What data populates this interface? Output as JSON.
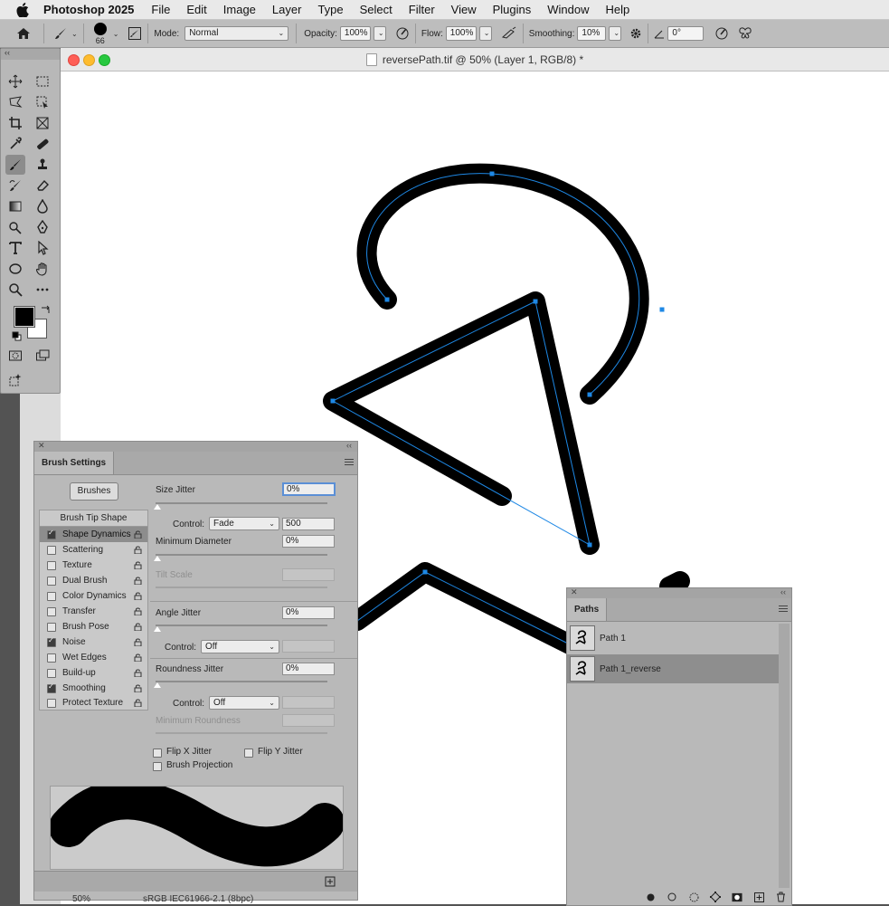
{
  "menubar": {
    "app": "Photoshop 2025",
    "items": [
      "File",
      "Edit",
      "Image",
      "Layer",
      "Type",
      "Select",
      "Filter",
      "View",
      "Plugins",
      "Window",
      "Help"
    ]
  },
  "options": {
    "brush_size": "66",
    "mode_label": "Mode:",
    "mode_value": "Normal",
    "opacity_label": "Opacity:",
    "opacity_value": "100%",
    "flow_label": "Flow:",
    "flow_value": "100%",
    "smoothing_label": "Smoothing:",
    "smoothing_value": "10%",
    "angle_value": "0°"
  },
  "document": {
    "title": "reversePath.tif @ 50% (Layer 1, RGB/8) *"
  },
  "colors": {
    "foreground": "#000000",
    "background": "#ffffff",
    "path_blue": "#1e88e5"
  },
  "brush_settings": {
    "tab": "Brush Settings",
    "brushes_button": "Brushes",
    "list_header": "Brush Tip Shape",
    "items": [
      {
        "label": "Shape Dynamics",
        "checked": true,
        "selected": true
      },
      {
        "label": "Scattering",
        "checked": false
      },
      {
        "label": "Texture",
        "checked": false
      },
      {
        "label": "Dual Brush",
        "checked": false
      },
      {
        "label": "Color Dynamics",
        "checked": false
      },
      {
        "label": "Transfer",
        "checked": false
      },
      {
        "label": "Brush Pose",
        "checked": false
      },
      {
        "label": "Noise",
        "checked": true
      },
      {
        "label": "Wet Edges",
        "checked": false
      },
      {
        "label": "Build-up",
        "checked": false
      },
      {
        "label": "Smoothing",
        "checked": true
      },
      {
        "label": "Protect Texture",
        "checked": false
      }
    ],
    "size_jitter_label": "Size Jitter",
    "size_jitter_value": "0%",
    "control_label": "Control:",
    "size_control_value": "Fade",
    "fade_steps": "500",
    "min_diameter_label": "Minimum Diameter",
    "min_diameter_value": "0%",
    "tilt_scale_label": "Tilt Scale",
    "angle_jitter_label": "Angle Jitter",
    "angle_jitter_value": "0%",
    "angle_control_value": "Off",
    "roundness_jitter_label": "Roundness Jitter",
    "roundness_jitter_value": "0%",
    "roundness_control_value": "Off",
    "min_roundness_label": "Minimum Roundness",
    "flip_x_label": "Flip X Jitter",
    "flip_y_label": "Flip Y Jitter",
    "brush_projection_label": "Brush Projection"
  },
  "paths": {
    "tab": "Paths",
    "items": [
      {
        "label": "Path 1",
        "selected": false
      },
      {
        "label": "Path 1_reverse",
        "selected": true
      }
    ]
  },
  "status": {
    "zoom": "50%",
    "profile": "sRGB IEC61966-2.1 (8bpc)"
  }
}
